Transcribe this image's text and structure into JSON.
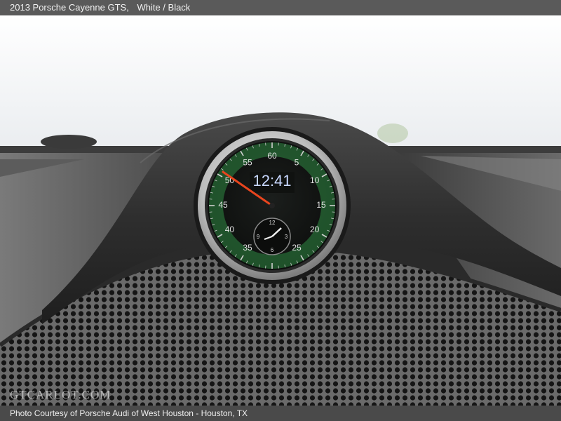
{
  "header": {
    "vehicle": "2013 Porsche Cayenne GTS,",
    "colors": "White / Black"
  },
  "clock": {
    "digital_time": "12:41",
    "scale_labels": [
      "60",
      "5",
      "10",
      "15",
      "20",
      "25",
      "35",
      "40",
      "45",
      "50",
      "55"
    ],
    "subdial_labels": [
      "12",
      "3",
      "6",
      "9"
    ]
  },
  "watermark": "GTCARLOT.COM",
  "footer": {
    "credit": "Photo Courtesy of Porsche Audi of West Houston - Houston, TX"
  },
  "colors": {
    "accent_green": "#3fae4b",
    "hand_red": "#e8451e",
    "logo_yellow": "#f2c200"
  }
}
